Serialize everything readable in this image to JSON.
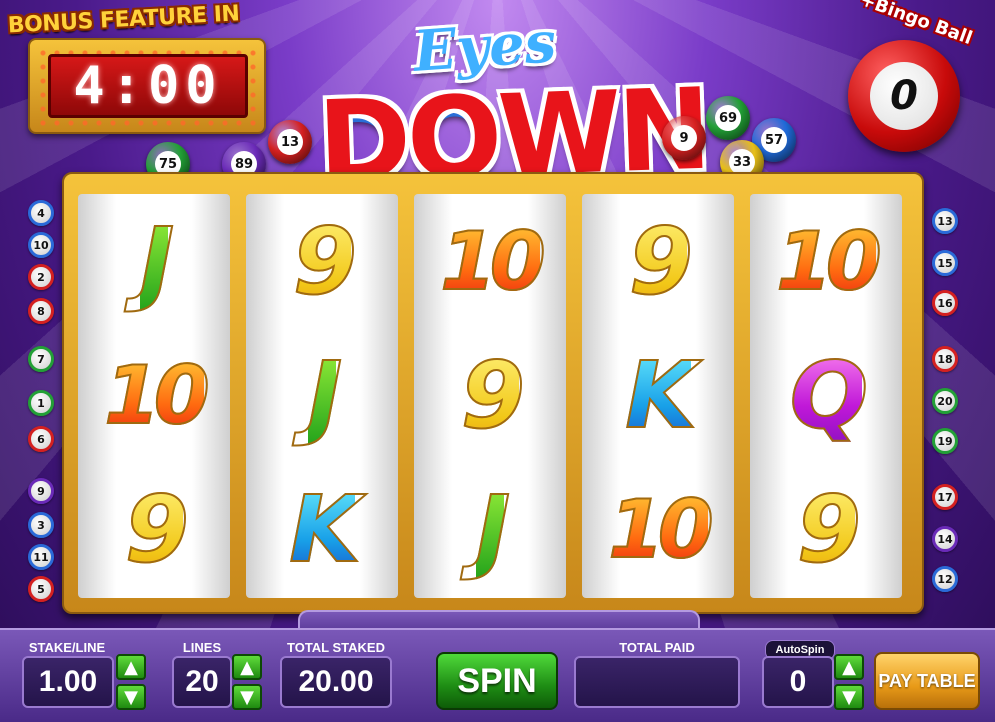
{
  "bonus": {
    "title": "BONUS FEATURE IN",
    "timer": "4:00"
  },
  "logo": {
    "top": "Eyes",
    "bottom": "DOWN"
  },
  "bingo_ball": {
    "label": "+Bingo Ball",
    "count": "0"
  },
  "drawn_balls_left": [
    {
      "num": "75",
      "color": "#22a036"
    },
    {
      "num": "89",
      "color": "#6a2ab8"
    },
    {
      "num": "13",
      "color": "#d42020"
    }
  ],
  "drawn_balls_right": [
    {
      "num": "9",
      "color": "#d42020"
    },
    {
      "num": "69",
      "color": "#22a036"
    },
    {
      "num": "57",
      "color": "#1f6ad8"
    },
    {
      "num": "33",
      "color": "#e8c018"
    }
  ],
  "reels": [
    [
      {
        "text": "J",
        "color": "green"
      },
      {
        "text": "10",
        "color": "orange"
      },
      {
        "text": "9",
        "color": "yellow"
      }
    ],
    [
      {
        "text": "9",
        "color": "yellow"
      },
      {
        "text": "J",
        "color": "green"
      },
      {
        "text": "K",
        "color": "blue"
      }
    ],
    [
      {
        "text": "10",
        "color": "orange"
      },
      {
        "text": "9",
        "color": "yellow"
      },
      {
        "text": "J",
        "color": "green"
      }
    ],
    [
      {
        "text": "9",
        "color": "yellow"
      },
      {
        "text": "K",
        "color": "blue"
      },
      {
        "text": "10",
        "color": "orange"
      }
    ],
    [
      {
        "text": "10",
        "color": "orange"
      },
      {
        "text": "Q",
        "color": "purple"
      },
      {
        "text": "9",
        "color": "yellow"
      }
    ]
  ],
  "left_lines": [
    "4",
    "10",
    "2",
    "8",
    "7",
    "1",
    "6",
    "9",
    "3",
    "11",
    "5"
  ],
  "right_lines": [
    "13",
    "15",
    "16",
    "18",
    "20",
    "19",
    "17",
    "14",
    "12"
  ],
  "controls": {
    "stake_label": "STAKE/LINE",
    "stake_value": "1.00",
    "lines_label": "LINES",
    "lines_value": "20",
    "total_staked_label": "TOTAL STAKED",
    "total_staked_value": "20.00",
    "spin_label": "SPIN",
    "total_paid_label": "TOTAL PAID",
    "total_paid_value": "",
    "autospin_label": "AutoSpin",
    "autospin_value": "0",
    "paytable_label": "PAY TABLE"
  }
}
